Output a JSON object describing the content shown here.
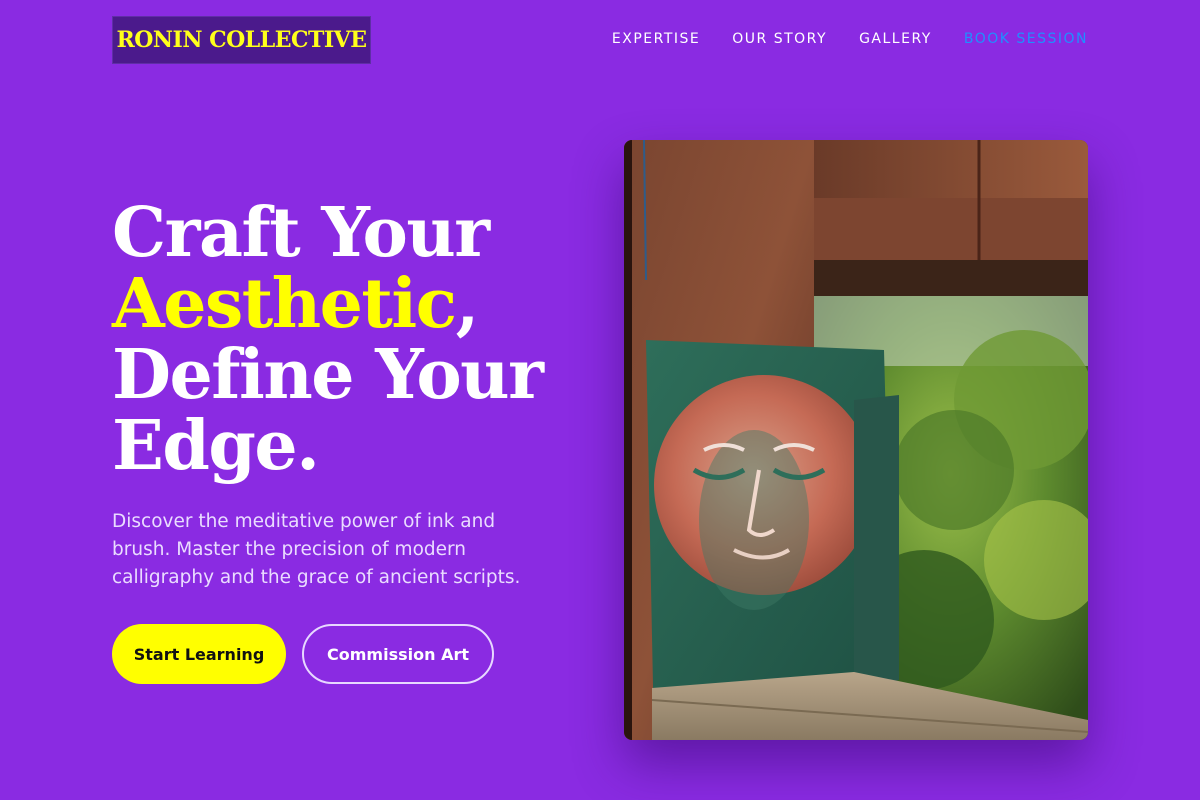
{
  "header": {
    "logo": "RONIN COLLECTIVE",
    "nav": [
      {
        "label": "EXPERTISE"
      },
      {
        "label": "OUR STORY"
      },
      {
        "label": "GALLERY"
      },
      {
        "label": "BOOK SESSION"
      }
    ]
  },
  "hero": {
    "headline_line1": "Craft Your",
    "headline_highlight": "Aesthetic",
    "headline_comma": ",",
    "headline_line3": "Define Your",
    "headline_line4": "Edge.",
    "subtitle": "Discover the meditative power of ink and brush. Master the precision of modern calligraphy and the grace of ancient scripts.",
    "primary_button": "Start Learning",
    "secondary_button": "Commission Art"
  },
  "colors": {
    "background": "#8a2be2",
    "accent_yellow": "#ffff00",
    "nav_accent": "#1e90ff",
    "logo_bg": "#4b1a8c"
  }
}
